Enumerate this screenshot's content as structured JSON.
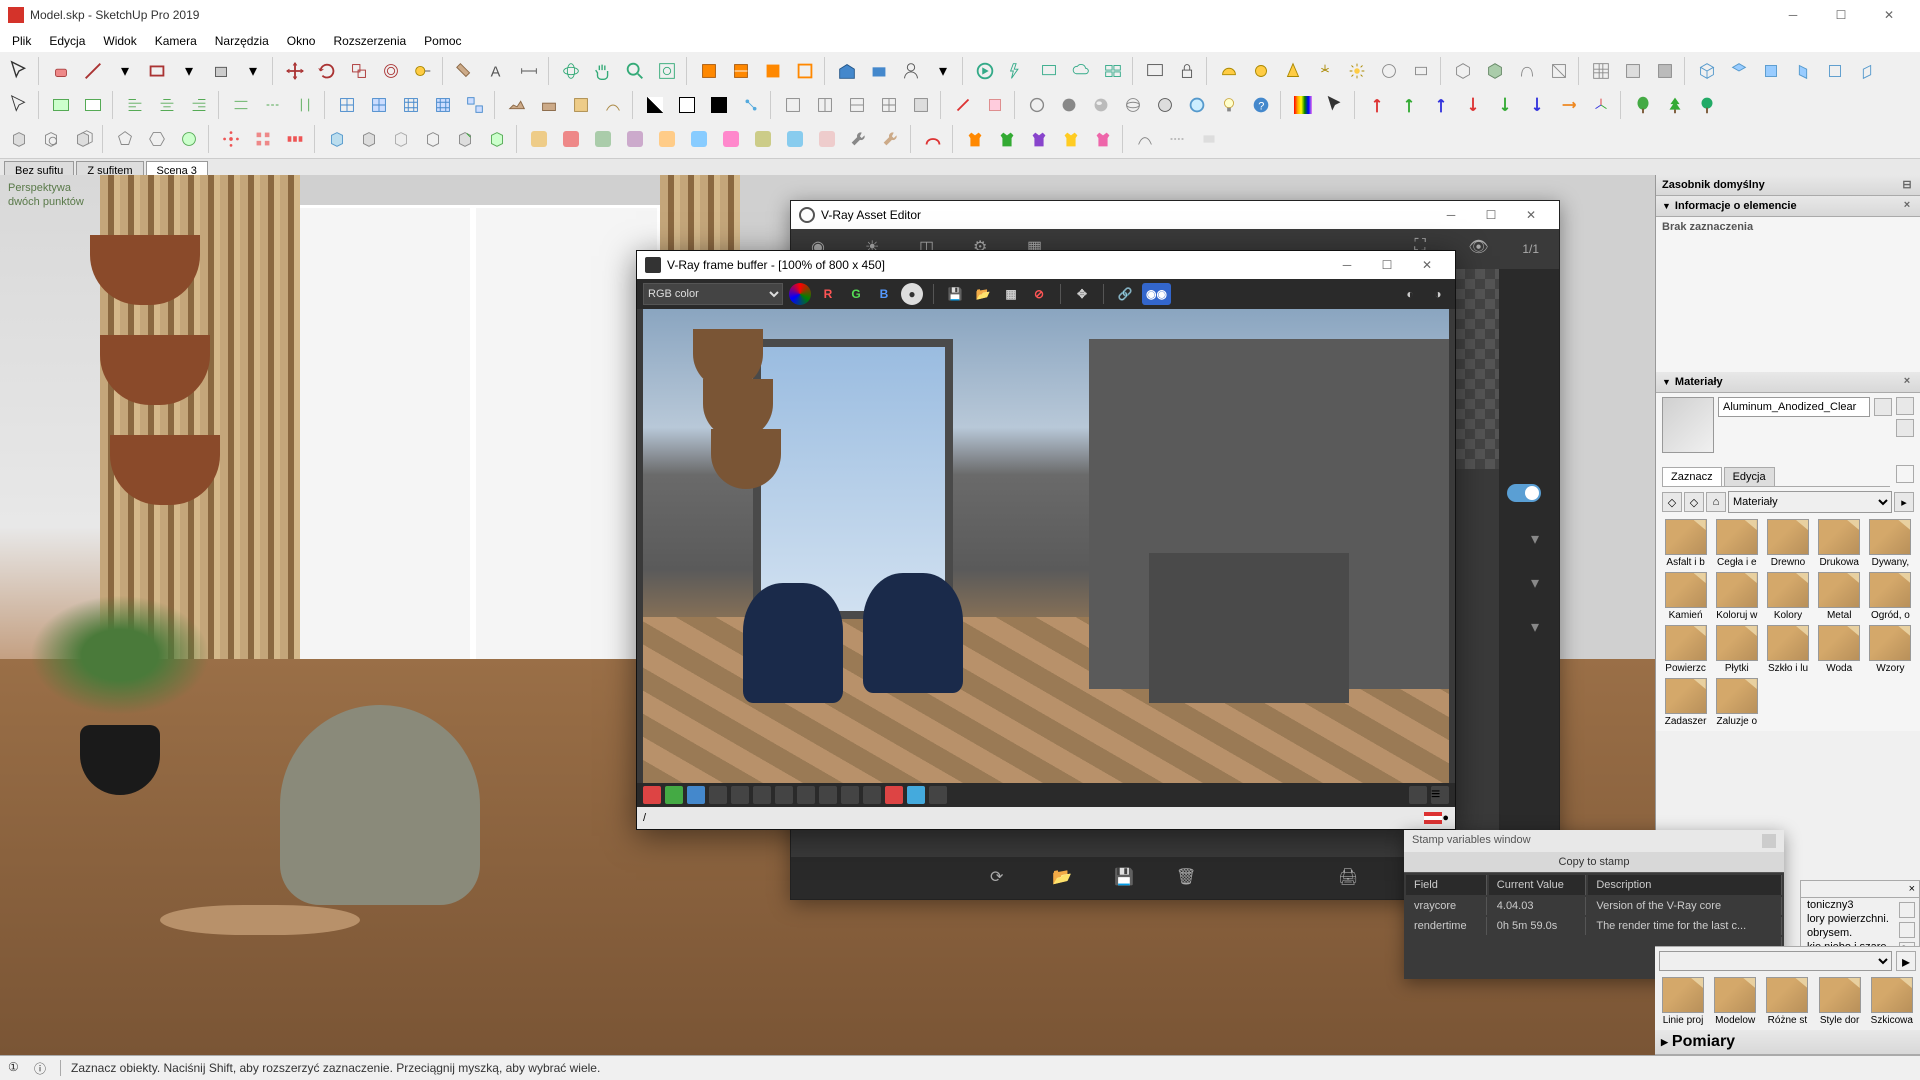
{
  "app": {
    "title": "Model.skp - SketchUp Pro 2019"
  },
  "menu": [
    "Plik",
    "Edycja",
    "Widok",
    "Kamera",
    "Narzędzia",
    "Okno",
    "Rozszerzenia",
    "Pomoc"
  ],
  "scene_tabs": [
    "Bez sufitu",
    "Z sufitem",
    "Scena 3"
  ],
  "viewport_label": "Perspektywa\ndwóch punktów",
  "right": {
    "tray_title": "Zasobnik domyślny",
    "info_header": "Informacje o elemencie",
    "info_body": "Brak zaznaczenia",
    "materials_header": "Materiały",
    "material_name": "Aluminum_Anodized_Clear",
    "tabs": {
      "select": "Zaznacz",
      "edit": "Edycja"
    },
    "mat_dropdown": "Materiały",
    "mat_folders": [
      "Asfalt i b",
      "Cegła i e",
      "Drewno",
      "Drukowa",
      "Dywany,",
      "Kamień",
      "Koloruj w",
      "Kolory",
      "Metal",
      "Ogród, o",
      "Powierzc",
      "Płytki",
      "Szkło i lu",
      "Woda",
      "Wzory",
      "Zadaszer",
      "Żaluzje o"
    ]
  },
  "vae": {
    "title": "V-Ray Asset Editor",
    "frac": "1/1"
  },
  "vfb": {
    "title": "V-Ray frame buffer - [100% of 800 x 450]",
    "channel_select": "RGB color",
    "status_slash": "/"
  },
  "stamp": {
    "title": "Stamp variables window",
    "copy": "Copy to stamp",
    "headers": {
      "field": "Field",
      "value": "Current Value",
      "desc": "Description"
    },
    "rows": [
      {
        "field": "vraycore",
        "value": "4.04.03",
        "desc": "Version of the V-Ray core"
      },
      {
        "field": "rendertime",
        "value": "0h  5m 59.0s",
        "desc": "The render time for the last c..."
      }
    ]
  },
  "style_frag": {
    "name": "toniczny3",
    "l1": "lory powierzchni.",
    "l2": "obrysem.",
    "l3": "kie niebo i szare"
  },
  "bottom_grid": {
    "folders": [
      "Linie proj",
      "Modelow",
      "Różne st",
      "Style dor",
      "Szkicowa"
    ],
    "pomiary": "Pomiary"
  },
  "status": {
    "hint": "Zaznacz obiekty. Naciśnij Shift, aby rozszerzyć zaznaczenie. Przeciągnij myszką, aby wybrać wiele."
  }
}
